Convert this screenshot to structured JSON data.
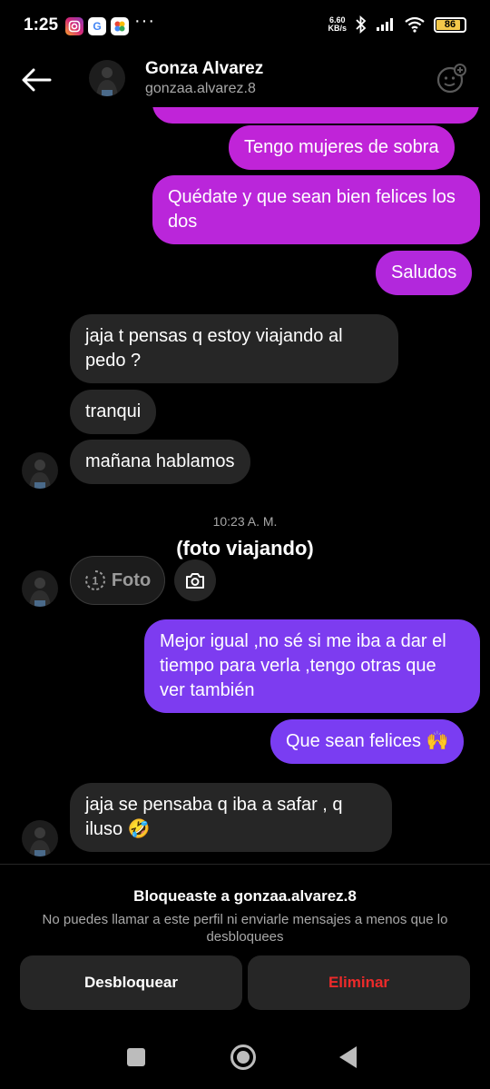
{
  "status_bar": {
    "time": "1:25",
    "app_icons": [
      "instagram-icon",
      "google-icon",
      "photos-icon"
    ],
    "more": "···",
    "net_speed_value": "6.60",
    "net_speed_unit": "KB/s",
    "battery": "86"
  },
  "header": {
    "name": "Gonza Alvarez",
    "username": "gonzaa.alvarez.8"
  },
  "messages": {
    "out_1": "Tengo mujeres de sobra",
    "out_2": "Quédate y que sean bien felices los dos",
    "out_3": "Saludos",
    "in_1": "jaja t pensas q estoy viajando al pedo ?",
    "in_2": "tranqui",
    "in_3": "mañana hablamos",
    "timestamp": "10:23 A. M.",
    "annotation": "(foto viajando)",
    "photo_label": "Foto",
    "photo_count": "1",
    "out_4": "Mejor igual ,no sé si me iba a dar el tiempo para verla ,tengo otras que ver también",
    "out_5": "Que sean felices 🙌",
    "in_4": "jaja se pensaba q iba a safar , q iluso 🤣"
  },
  "blocked": {
    "title": "Bloqueaste a gonzaa.alvarez.8",
    "description": "No puedes llamar a este perfil ni enviarle mensajes a menos que lo desbloquees",
    "unblock_label": "Desbloquear",
    "delete_label": "Eliminar"
  },
  "colors": {
    "bubble_magenta": "#c624d9",
    "bubble_violet": "#7b3df2",
    "bubble_incoming": "#262626",
    "delete_red": "#ed2a2a"
  }
}
